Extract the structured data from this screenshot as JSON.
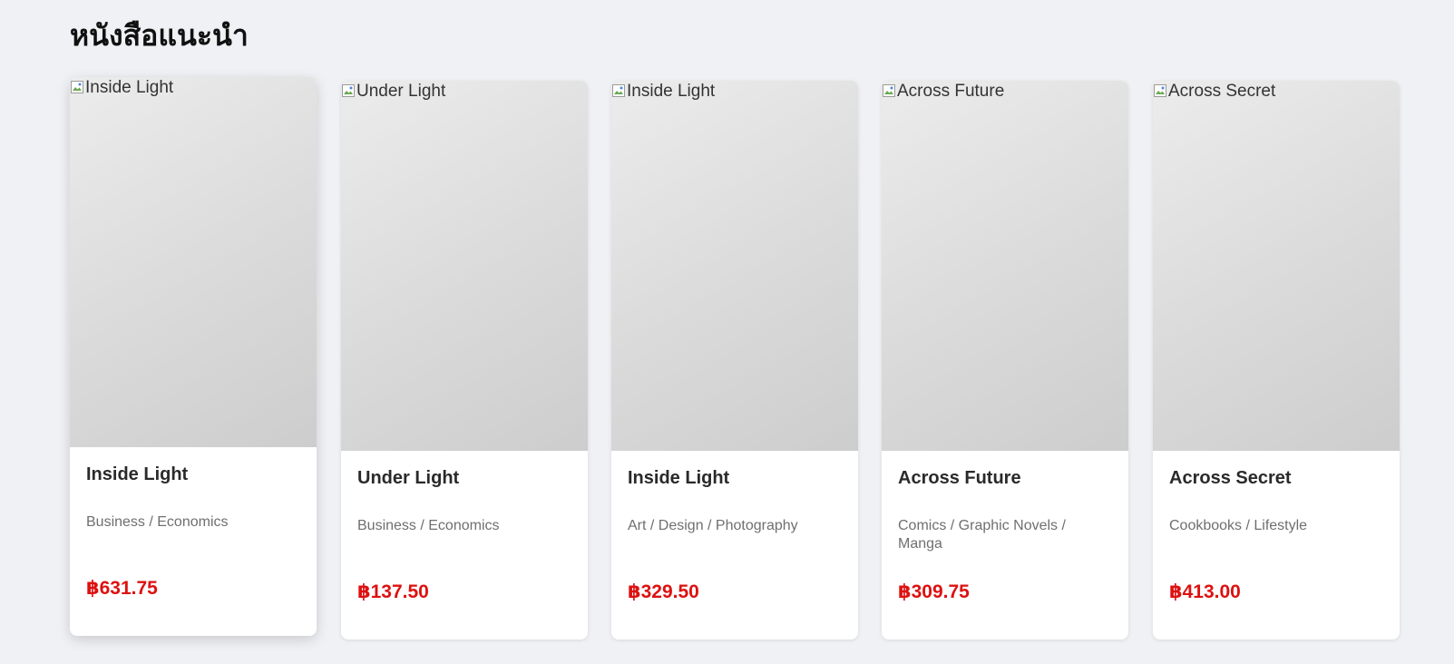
{
  "section": {
    "title": "หนังสือแนะนำ"
  },
  "books": [
    {
      "alt": "Inside Light",
      "title": "Inside Light",
      "category": "Business / Economics",
      "price": "฿631.75"
    },
    {
      "alt": "Under Light",
      "title": "Under Light",
      "category": "Business / Economics",
      "price": "฿137.50"
    },
    {
      "alt": "Inside Light",
      "title": "Inside Light",
      "category": "Art / Design / Photography",
      "price": "฿329.50"
    },
    {
      "alt": "Across Future",
      "title": "Across Future",
      "category": "Comics / Graphic Novels / Manga",
      "price": "฿309.75"
    },
    {
      "alt": "Across Secret",
      "title": "Across Secret",
      "category": "Cookbooks / Lifestyle",
      "price": "฿413.00"
    }
  ],
  "colors": {
    "page_background": "#f0f1f4",
    "price": "#dd1111",
    "category_text": "#6f6f6f",
    "cover_gradient_start": "#ececec",
    "cover_gradient_end": "#cdcdcd"
  },
  "icons": {
    "cover_placeholder": "broken-image-icon"
  }
}
